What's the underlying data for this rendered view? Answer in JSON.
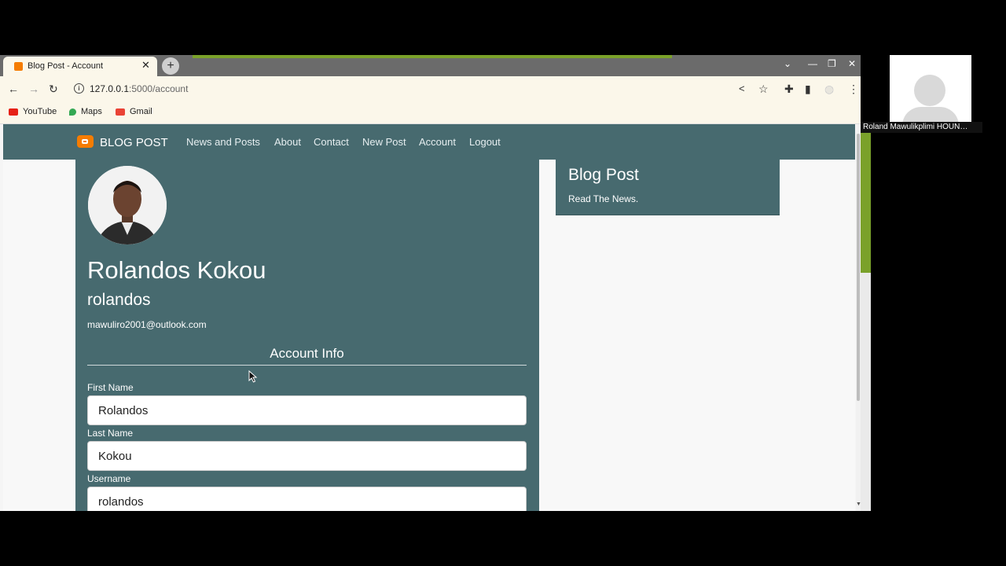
{
  "browser": {
    "tab_title": "Blog Post - Account",
    "tab_close": "✕",
    "new_tab": "+",
    "url_host": "127.0.0.1",
    "url_rest": ":5000/account",
    "bookmarks": [
      {
        "label": "YouTube",
        "color": "#e62117"
      },
      {
        "label": "Maps",
        "color": "#34a853"
      },
      {
        "label": "Gmail",
        "color": "#ea4335"
      }
    ]
  },
  "nav": {
    "brand": "BLOG POST",
    "links": [
      "News and Posts",
      "About",
      "Contact",
      "New Post",
      "Account",
      "Logout"
    ]
  },
  "profile": {
    "full_name": "Rolandos Kokou",
    "username": "rolandos",
    "email": "mawuliro2001@outlook.com",
    "section_title": "Account Info"
  },
  "form": {
    "first_name_label": "First Name",
    "first_name_value": "Rolandos",
    "last_name_label": "Last Name",
    "last_name_value": "Kokou",
    "username_label": "Username",
    "username_value": "rolandos"
  },
  "sidebar": {
    "title": "Blog Post",
    "subtitle": "Read The News."
  },
  "meeting": {
    "participant_name": "Roland Mawulikplimi HOUN…"
  },
  "colors": {
    "navbar": "#476a6f",
    "accent": "#7aa12a",
    "brand_logo": "#f57c00"
  }
}
